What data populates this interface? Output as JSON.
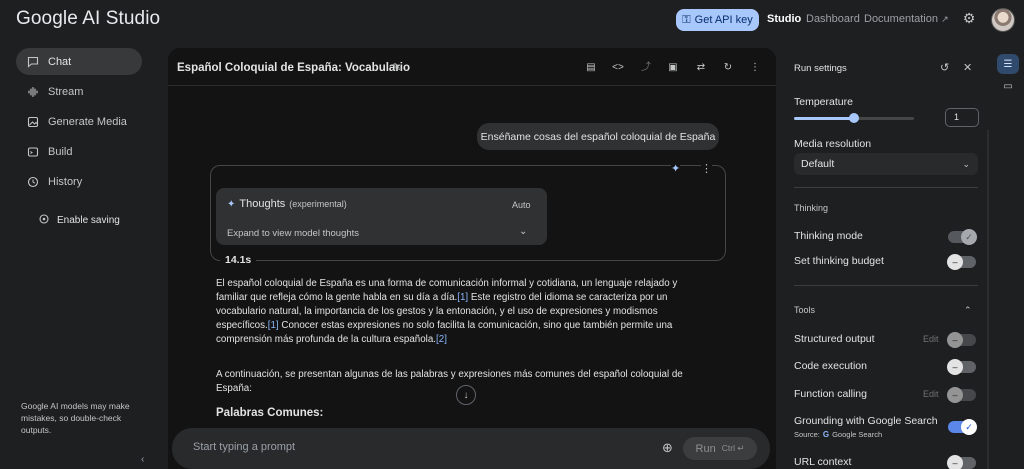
{
  "header": {
    "brand": "Google AI Studio",
    "api_key_button": "Get API key",
    "api_key_icon": "key-icon",
    "links": {
      "studio": "Studio",
      "dashboard": "Dashboard",
      "documentation": "Documentation"
    },
    "accent": "#a8c7fa"
  },
  "sidebar": {
    "items": [
      {
        "label": "Chat",
        "icon": "chat-icon"
      },
      {
        "label": "Stream",
        "icon": "waveform-icon"
      },
      {
        "label": "Generate Media",
        "icon": "media-icon"
      },
      {
        "label": "Build",
        "icon": "build-icon"
      },
      {
        "label": "History",
        "icon": "history-icon"
      }
    ],
    "enable_saving": "Enable saving",
    "note": "Google AI models may make mistakes, so double-check outputs."
  },
  "chat": {
    "title": "Español Coloquial de España: Vocabulario",
    "user_message": "Enséñame cosas del español coloquial de España",
    "thoughts": {
      "title": "Thoughts",
      "tag": "(experimental)",
      "mode": "Auto",
      "expand_label": "Expand to view model thoughts"
    },
    "elapsed": "14.1s",
    "paragraph1": {
      "part1": "El español coloquial de España es una forma de comunicación informal y cotidiana, un lenguaje relajado y familiar que refleja cómo la gente habla en su día a día.",
      "cite1": "[1]",
      "part2": " Este registro del idioma se caracteriza por un vocabulario natural, la importancia de los gestos y la entonación, y el uso de expresiones y modismos específicos.",
      "cite2": "[1]",
      "part3": " Conocer estas expresiones no solo facilita la comunicación, sino que también permite una comprensión más profunda de la cultura española.",
      "cite3": "[2]"
    },
    "paragraph2": "A continuación, se presentan algunas de las palabras y expresiones más comunes del español coloquial de España:",
    "heading": "Palabras Comunes:",
    "prompt_placeholder": "Start typing a prompt",
    "run_label": "Run",
    "run_shortcut": "Ctrl ↵"
  },
  "settings": {
    "title": "Run settings",
    "temperature_label": "Temperature",
    "temperature_value": "1",
    "temperature_fraction": 0.5,
    "media_resolution_label": "Media resolution",
    "media_resolution_value": "Default",
    "thinking_section": "Thinking",
    "thinking_mode": "Thinking mode",
    "thinking_mode_on": true,
    "set_thinking_budget": "Set thinking budget",
    "set_thinking_budget_on": false,
    "tools_section": "Tools",
    "structured_output": "Structured output",
    "code_execution": "Code execution",
    "function_calling": "Function calling",
    "edit_label": "Edit",
    "grounding": "Grounding with Google Search",
    "grounding_on": true,
    "source_label": "Source:",
    "source_value": "Google Search",
    "url_context": "URL context"
  }
}
